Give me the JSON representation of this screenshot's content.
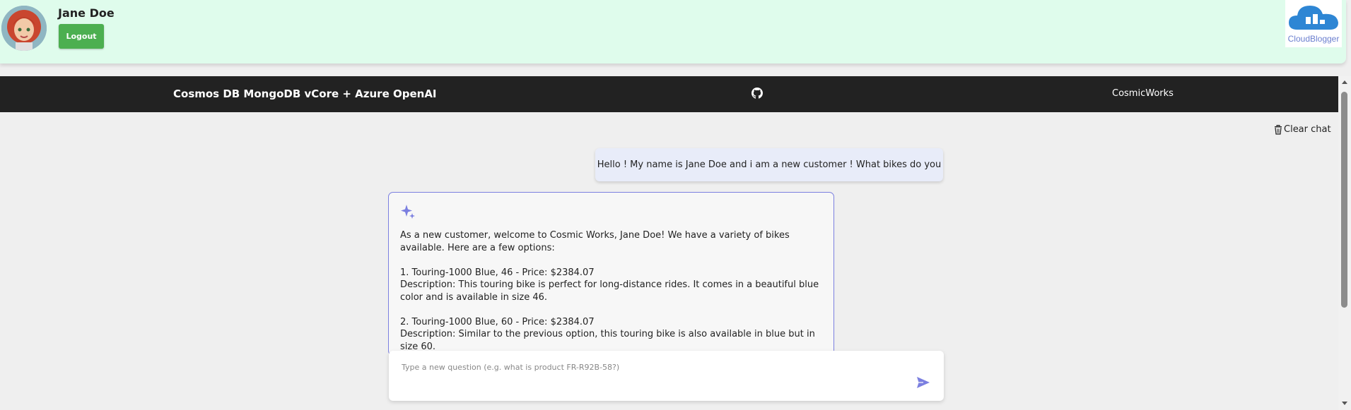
{
  "user": {
    "name": "Jane Doe",
    "logout_label": "Logout"
  },
  "brand": {
    "name": "CloudBlogger",
    "color": "#2e86d4"
  },
  "navbar": {
    "title": "Cosmos DB MongoDB vCore + Azure OpenAI",
    "github_icon": "github-icon",
    "right_link": "CosmicWorks"
  },
  "chat": {
    "clear_label": "Clear chat",
    "user_message": "Hello ! My name is Jane Doe and i am a new customer ! What bikes do you have ?",
    "bot_lines": [
      "As a new customer, welcome to Cosmic Works, Jane Doe! We have a variety of bikes available. Here are a few options:",
      "1. Touring-1000 Blue, 46 - Price: $2384.07",
      "Description: This touring bike is perfect for long-distance rides. It comes in a beautiful blue color and is available in size 46.",
      "2. Touring-1000 Blue, 60 - Price: $2384.07",
      "Description: Similar to the previous option, this touring bike is also available in blue but in size 60."
    ],
    "input_placeholder": "Type a new question (e.g. what is product FR-R92B-58?)"
  },
  "colors": {
    "userbar_bg": "#dffcec",
    "navbar_bg": "#222222",
    "logout_bg": "#4caf50",
    "accent": "#7b7fe0"
  }
}
